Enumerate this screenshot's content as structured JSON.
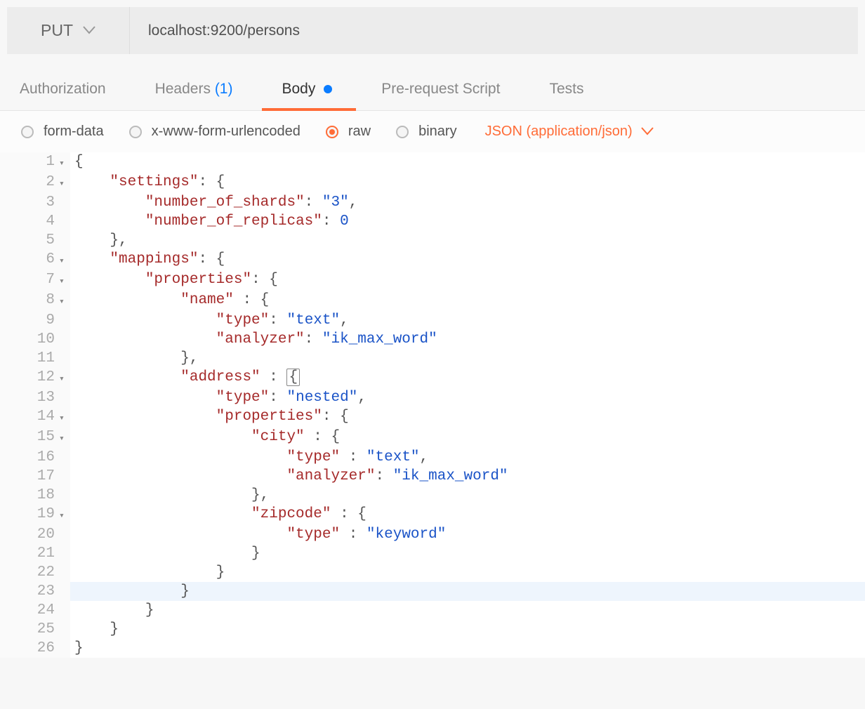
{
  "request": {
    "method": "PUT",
    "url": "localhost:9200/persons"
  },
  "tabs": {
    "authorization": "Authorization",
    "headers_label": "Headers",
    "headers_count": "(1)",
    "body": "Body",
    "prerequest": "Pre-request Script",
    "tests": "Tests"
  },
  "bodyTypes": {
    "formdata": "form-data",
    "urlencoded": "x-www-form-urlencoded",
    "raw": "raw",
    "binary": "binary",
    "contentType": "JSON (application/json)"
  },
  "lines": [
    {
      "n": "1",
      "f": "▾",
      "h": "<span class='p'>{</span>"
    },
    {
      "n": "2",
      "f": "▾",
      "h": "    <span class='k'>\"settings\"</span><span class='p'>: {</span>"
    },
    {
      "n": "3",
      "f": "",
      "h": "        <span class='k'>\"number_of_shards\"</span><span class='p'>: </span><span class='s'>\"3\"</span><span class='p'>,</span>"
    },
    {
      "n": "4",
      "f": "",
      "h": "        <span class='k'>\"number_of_replicas\"</span><span class='p'>: </span><span class='n'>0</span>"
    },
    {
      "n": "5",
      "f": "",
      "h": "    <span class='p'>},</span>"
    },
    {
      "n": "6",
      "f": "▾",
      "h": "    <span class='k'>\"mappings\"</span><span class='p'>: {</span>"
    },
    {
      "n": "7",
      "f": "▾",
      "h": "        <span class='k'>\"properties\"</span><span class='p'>: {</span>"
    },
    {
      "n": "8",
      "f": "▾",
      "h": "            <span class='k'>\"name\"</span> <span class='p'>: {</span>"
    },
    {
      "n": "9",
      "f": "",
      "h": "                <span class='k'>\"type\"</span><span class='p'>: </span><span class='s'>\"text\"</span><span class='p'>,</span>"
    },
    {
      "n": "10",
      "f": "",
      "h": "                <span class='k'>\"analyzer\"</span><span class='p'>: </span><span class='s'>\"ik_max_word\"</span>"
    },
    {
      "n": "11",
      "f": "",
      "h": "            <span class='p'>},</span>"
    },
    {
      "n": "12",
      "f": "▾",
      "h": "            <span class='k'>\"address\"</span> <span class='p'>: </span><span class='p' style='border:1px solid #888;padding:0 2px;border-radius:2px;'>{</span>"
    },
    {
      "n": "13",
      "f": "",
      "h": "                <span class='k'>\"type\"</span><span class='p'>: </span><span class='s'>\"nested\"</span><span class='p'>,</span>"
    },
    {
      "n": "14",
      "f": "▾",
      "h": "                <span class='k'>\"properties\"</span><span class='p'>: {</span>"
    },
    {
      "n": "15",
      "f": "▾",
      "h": "                    <span class='k'>\"city\"</span> <span class='p'>: {</span>"
    },
    {
      "n": "16",
      "f": "",
      "h": "                        <span class='k'>\"type\"</span> <span class='p'>: </span><span class='s'>\"text\"</span><span class='p'>,</span>"
    },
    {
      "n": "17",
      "f": "",
      "h": "                        <span class='k'>\"analyzer\"</span><span class='p'>: </span><span class='s'>\"ik_max_word\"</span>"
    },
    {
      "n": "18",
      "f": "",
      "h": "                    <span class='p'>},</span>"
    },
    {
      "n": "19",
      "f": "▾",
      "h": "                    <span class='k'>\"zipcode\"</span> <span class='p'>: {</span>"
    },
    {
      "n": "20",
      "f": "",
      "h": "                        <span class='k'>\"type\"</span> <span class='p'>: </span><span class='s'>\"keyword\"</span>"
    },
    {
      "n": "21",
      "f": "",
      "h": "                    <span class='p'>}</span>"
    },
    {
      "n": "22",
      "f": "",
      "h": "                <span class='p'>}</span>"
    },
    {
      "n": "23",
      "f": "",
      "hl": true,
      "h": "            <span class='p'>}</span>"
    },
    {
      "n": "24",
      "f": "",
      "h": "        <span class='p'>}</span>"
    },
    {
      "n": "25",
      "f": "",
      "h": "    <span class='p'>}</span>"
    },
    {
      "n": "26",
      "f": "",
      "h": "<span class='p'>}</span>"
    }
  ],
  "request_body_value": {
    "settings": {
      "number_of_shards": "3",
      "number_of_replicas": 0
    },
    "mappings": {
      "properties": {
        "name": {
          "type": "text",
          "analyzer": "ik_max_word"
        },
        "address": {
          "type": "nested",
          "properties": {
            "city": {
              "type": "text",
              "analyzer": "ik_max_word"
            },
            "zipcode": {
              "type": "keyword"
            }
          }
        }
      }
    }
  }
}
